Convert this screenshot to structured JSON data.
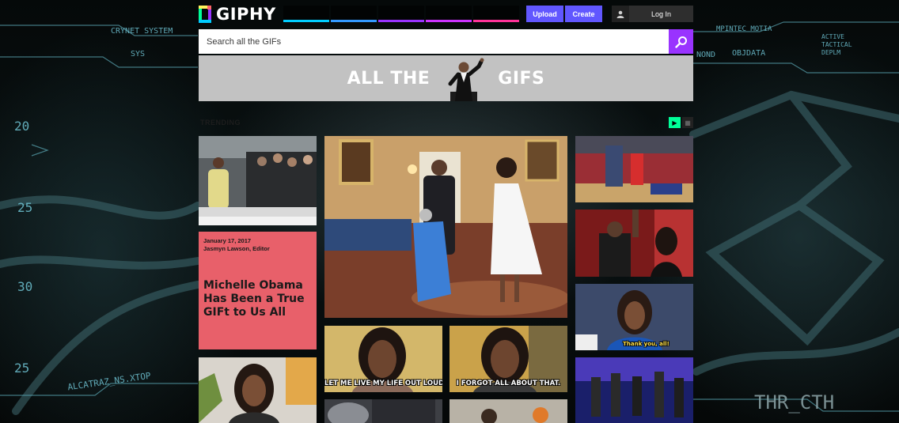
{
  "app": {
    "logo_text": "GIPHY"
  },
  "header": {
    "upload_label": "Upload",
    "create_label": "Create",
    "login_label": "Log In"
  },
  "search": {
    "placeholder": "Search all the GIFs"
  },
  "banner": {
    "left_text": "ALL THE",
    "right_text": "GIFS"
  },
  "trending": {
    "label": "TRENDING"
  },
  "story": {
    "date": "January 17, 2017",
    "author": "Jasmyn Lawson, Editor",
    "headline": "Michelle Obama Has Been a True GIFt to Us All"
  },
  "captions": {
    "gif_left": "LET ME LIVE MY LIFE OUT LOUD.",
    "gif_right": "I FORGOT ALL ABOUT THAT.",
    "gif_podium": "Thank you, all!"
  },
  "background_hud": {
    "labels": [
      "CRYNET SYSTEM",
      "SYS",
      "MPINTEC MOTIA",
      "OBJDATA",
      "NOND",
      "ACTIVE",
      "TACTICAL",
      "DEPLM",
      "ALCATRAZ_NS.XTOP",
      "THR_CTH"
    ],
    "numbers": [
      "20",
      "25",
      "30",
      "25"
    ]
  },
  "colors": {
    "accent_purple": "#9933ff",
    "button_blue": "#6157ff",
    "logo_green": "#00ff99",
    "story_bg": "#e8606a",
    "banner_bg": "#c2c2c2"
  },
  "icons": [
    "giphy-logo-icon",
    "user-icon",
    "search-icon",
    "play-icon",
    "grid-icon"
  ]
}
